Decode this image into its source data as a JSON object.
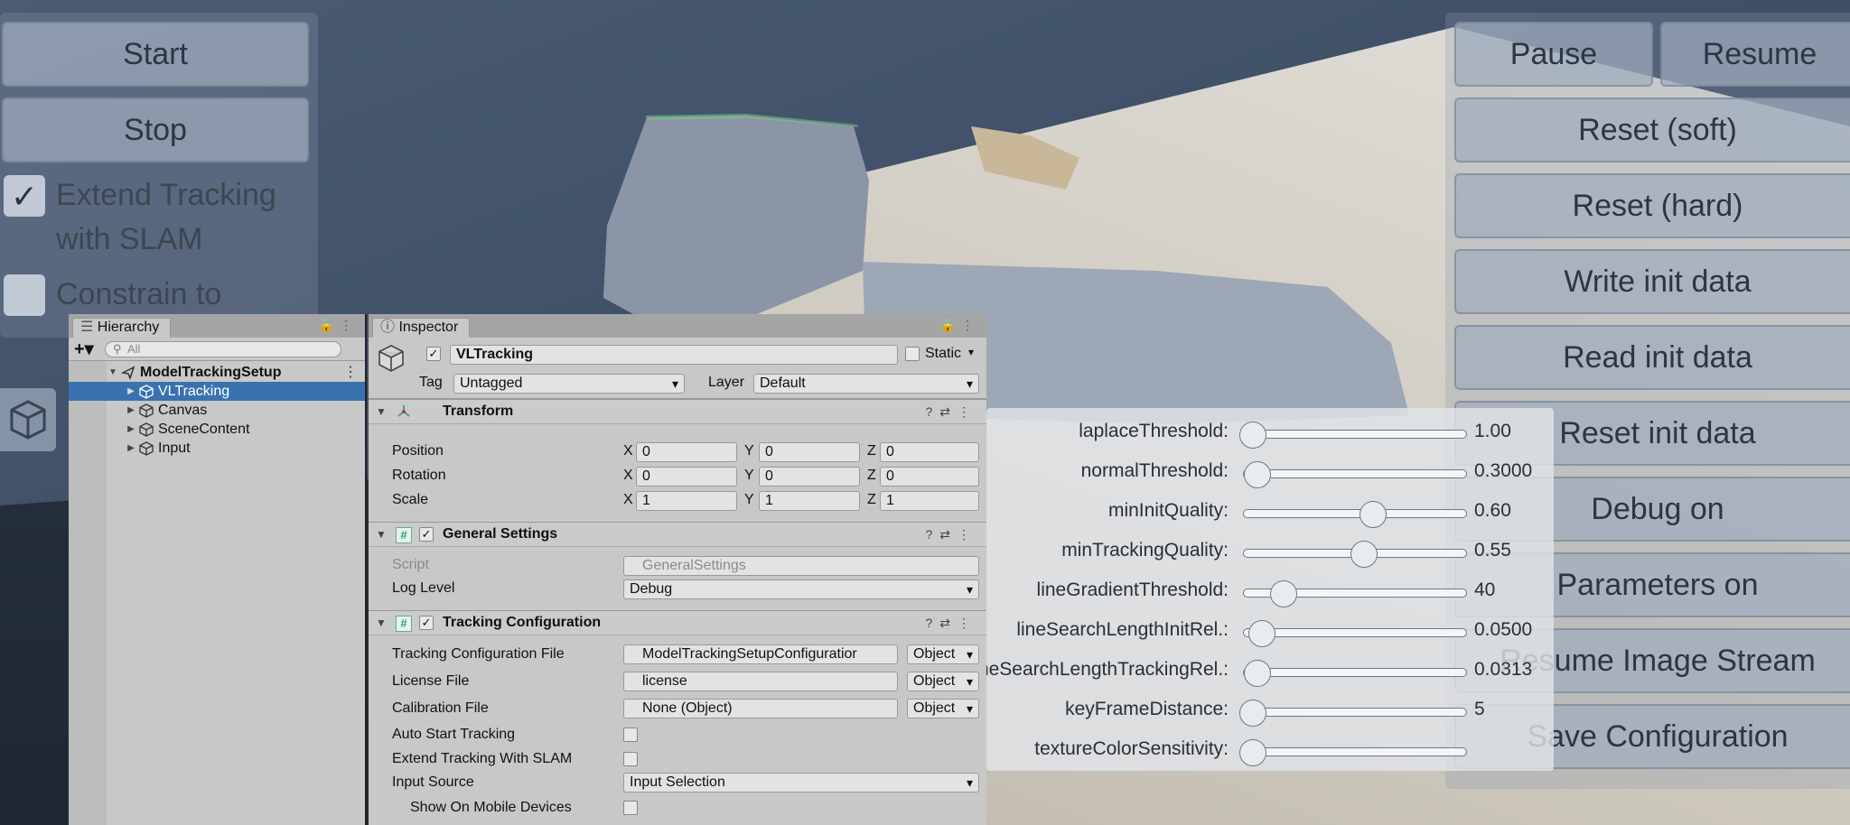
{
  "left_panel": {
    "start_label": "Start",
    "stop_label": "Stop",
    "extend_tracking_label": "Extend Tracking with SLAM",
    "constrain_label": "Constrain to"
  },
  "right_panel": {
    "pause_label": "Pause",
    "resume_label": "Resume",
    "reset_soft_label": "Reset (soft)",
    "reset_hard_label": "Reset (hard)",
    "write_init_label": "Write init data",
    "read_init_label": "Read init data",
    "reset_init_label": "Reset init data",
    "debug_label": "Debug on",
    "parameters_label": "Parameters on",
    "resume_stream_label": "Resume Image Stream",
    "save_config_label": "Save Configuration"
  },
  "params": [
    {
      "label": "laplaceThreshold:",
      "value": "1.00",
      "fraction": 0.04
    },
    {
      "label": "normalThreshold:",
      "value": "0.3000",
      "fraction": 0.06
    },
    {
      "label": "minInitQuality:",
      "value": "0.60",
      "fraction": 0.58
    },
    {
      "label": "minTrackingQuality:",
      "value": "0.55",
      "fraction": 0.54
    },
    {
      "label": "lineGradientThreshold:",
      "value": "40",
      "fraction": 0.18
    },
    {
      "label": "lineSearchLengthInitRel.:",
      "value": "0.0500",
      "fraction": 0.08
    },
    {
      "label": "lineSearchLengthTrackingRel.:",
      "value": "0.0313",
      "fraction": 0.06
    },
    {
      "label": "keyFrameDistance:",
      "value": "5",
      "fraction": 0.04
    },
    {
      "label": "textureColorSensitivity:",
      "value": "",
      "fraction": 0.04
    }
  ],
  "hierarchy": {
    "tab_label": "Hierarchy",
    "search_placeholder": "All",
    "root": "ModelTrackingSetup",
    "items": [
      "VLTracking",
      "Canvas",
      "SceneContent",
      "Input"
    ]
  },
  "inspector": {
    "tab_label": "Inspector",
    "object_name": "VLTracking",
    "static_label": "Static",
    "tag_label": "Tag",
    "tag_value": "Untagged",
    "layer_label": "Layer",
    "layer_value": "Default",
    "transform": {
      "title": "Transform",
      "rows": [
        {
          "label": "Position",
          "x": "0",
          "y": "0",
          "z": "0"
        },
        {
          "label": "Rotation",
          "x": "0",
          "y": "0",
          "z": "0"
        },
        {
          "label": "Scale",
          "x": "1",
          "y": "1",
          "z": "1"
        }
      ]
    },
    "general": {
      "title": "General Settings",
      "script_label": "Script",
      "script_value": "GeneralSettings",
      "log_level_label": "Log Level",
      "log_level_value": "Debug"
    },
    "tracking": {
      "title": "Tracking Configuration",
      "config_file_label": "Tracking Configuration File",
      "config_file_value": "ModelTrackingSetupConfiguratior",
      "license_label": "License File",
      "license_value": "license",
      "calibration_label": "Calibration File",
      "calibration_value": "None (Object)",
      "object_label": "Object",
      "auto_start_label": "Auto Start Tracking",
      "extend_slam_label": "Extend Tracking With SLAM",
      "input_source_label": "Input Source",
      "input_source_value": "Input Selection",
      "show_mobile_label": "Show On Mobile Devices"
    }
  }
}
